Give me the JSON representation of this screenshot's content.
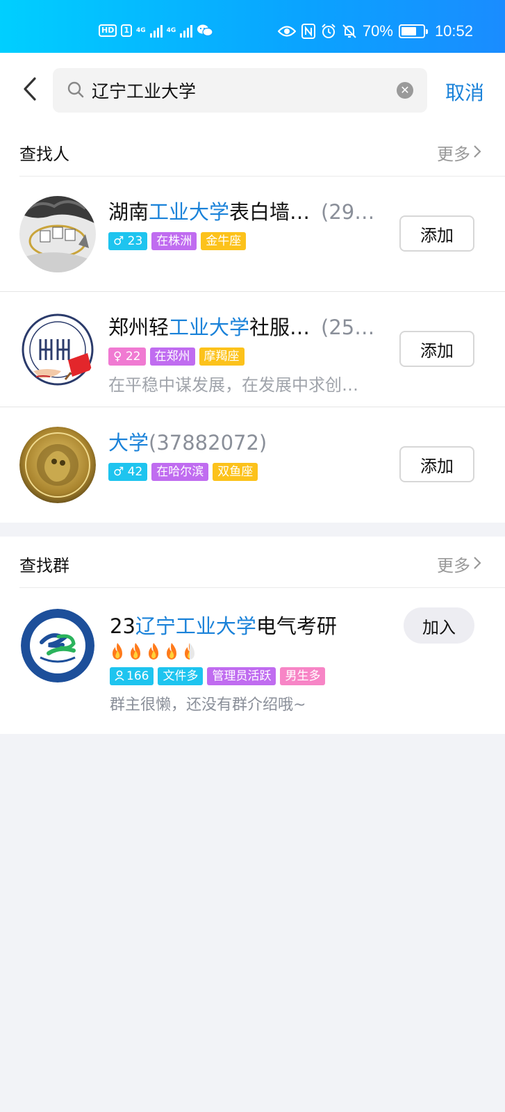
{
  "status_bar": {
    "hd_label": "HD",
    "sim_label": "1",
    "net1": "4G",
    "net2": "4G",
    "battery_percent_text": "70%",
    "battery_level": 0.7,
    "time": "10:52",
    "icons": [
      "eye-icon",
      "nfc-icon",
      "alarm-icon",
      "mute-icon",
      "wechat-icon"
    ]
  },
  "search": {
    "value": "辽宁工业大学",
    "cancel_label": "取消"
  },
  "people_section": {
    "title": "查找人",
    "more_label": "更多",
    "items": [
      {
        "name_prefix": "湖南",
        "name_highlight": "工业大学",
        "name_suffix": "表白墙…",
        "number": "(29…",
        "tags": [
          "♂ 23",
          "在株洲",
          "金牛座"
        ],
        "action": "添加"
      },
      {
        "name_prefix": "郑州轻",
        "name_highlight": "工业大学",
        "name_suffix": "社服…",
        "number": "(25…",
        "tags": [
          "♀ 22",
          "在郑州",
          "摩羯座"
        ],
        "signature": "在平稳中谋发展，在发展中求创…",
        "action": "添加"
      },
      {
        "name_prefix": "",
        "name_highlight": "大学",
        "name_suffix": "",
        "number": "(37882072)",
        "tags": [
          "♂ 42",
          "在哈尔滨",
          "双鱼座"
        ],
        "action": "添加"
      }
    ]
  },
  "groups_section": {
    "title": "查找群",
    "more_label": "更多",
    "items": [
      {
        "name_prefix": "23",
        "name_highlight": "辽宁工业大学",
        "name_suffix": "电气考研",
        "flame_level": 4.5,
        "tags": [
          "166",
          "文件多",
          "管理员活跃",
          "男生多"
        ],
        "description": "群主很懒，还没有群介绍哦~",
        "action": "加入"
      }
    ]
  },
  "colors": {
    "accent": "#1a82d9",
    "status_gradient_start": "#00cfff",
    "status_gradient_end": "#1a8cff"
  }
}
